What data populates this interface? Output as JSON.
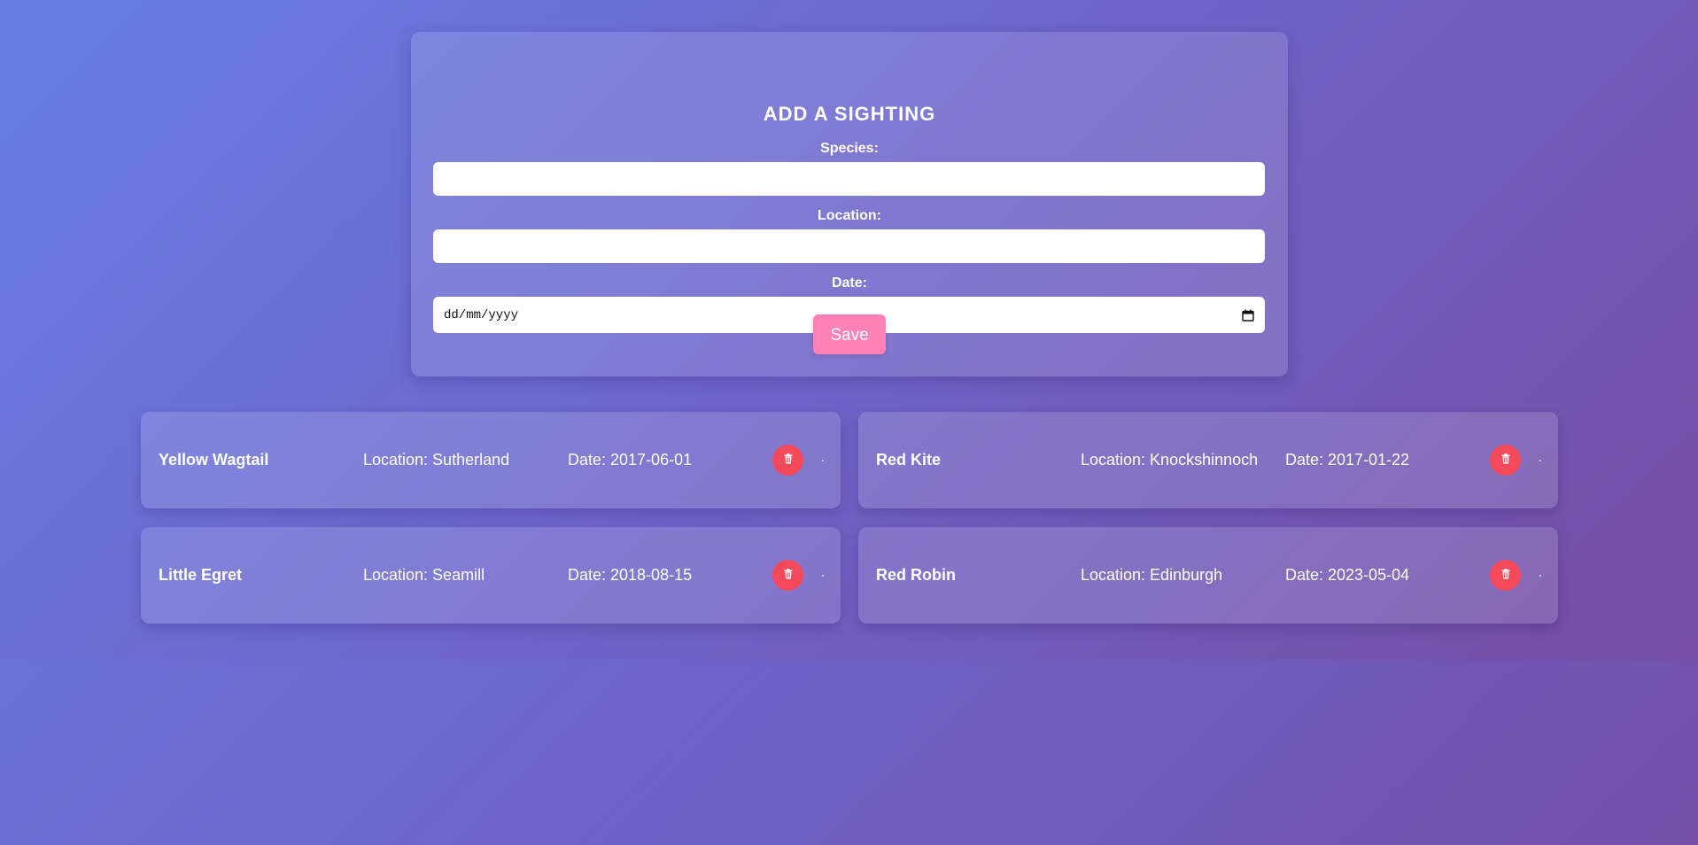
{
  "form": {
    "title": "ADD A SIGHTING",
    "species_label": "Species:",
    "species_value": "",
    "location_label": "Location:",
    "location_value": "",
    "date_label": "Date:",
    "date_placeholder": "dd/mm/yyyy",
    "save_label": "Save"
  },
  "sightings": [
    {
      "species": "Yellow Wagtail",
      "location": "Location: Sutherland",
      "date": "Date: 2017-06-01"
    },
    {
      "species": "Red Kite",
      "location": "Location: Knockshinnoch",
      "date": "Date: 2017-01-22"
    },
    {
      "species": "Little Egret",
      "location": "Location: Seamill",
      "date": "Date: 2018-08-15"
    },
    {
      "species": "Red Robin",
      "location": "Location: Edinburgh",
      "date": "Date: 2023-05-04"
    }
  ],
  "icons": {
    "delete": "trash-icon",
    "calendar": "calendar-icon"
  },
  "colors": {
    "save_button": "#ff82b6",
    "delete_button": "#f4495a",
    "text": "#ffffff"
  }
}
